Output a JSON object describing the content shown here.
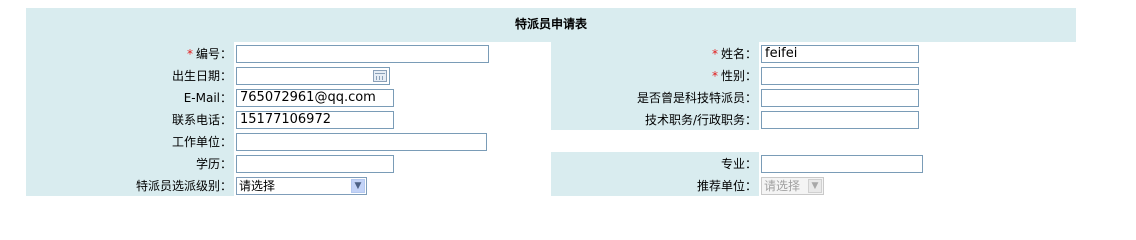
{
  "form": {
    "title": "特派员申请表",
    "required_mark": "*",
    "fields": {
      "bianhao": {
        "label": "编号：",
        "value": ""
      },
      "xingming": {
        "label": "姓名：",
        "value": "feifei"
      },
      "birth": {
        "label": "出生日期：",
        "value": ""
      },
      "gender": {
        "label": "性别：",
        "value": ""
      },
      "email": {
        "label": "E-Mail：",
        "value": "765072961@qq.com"
      },
      "tech_before": {
        "label": "是否曾是科技特派员：",
        "value": ""
      },
      "phone": {
        "label": "联系电话：",
        "value": "15177106972"
      },
      "position": {
        "label": "技术职务/行政职务：",
        "value": ""
      },
      "workplace": {
        "label": "工作单位：",
        "value": ""
      },
      "education": {
        "label": "学历：",
        "value": ""
      },
      "major": {
        "label": "专业：",
        "value": ""
      },
      "level": {
        "label": "特派员选派级别：",
        "selected": "请选择"
      },
      "recommend": {
        "label": "推荐单位：",
        "selected": "请选择"
      }
    }
  }
}
